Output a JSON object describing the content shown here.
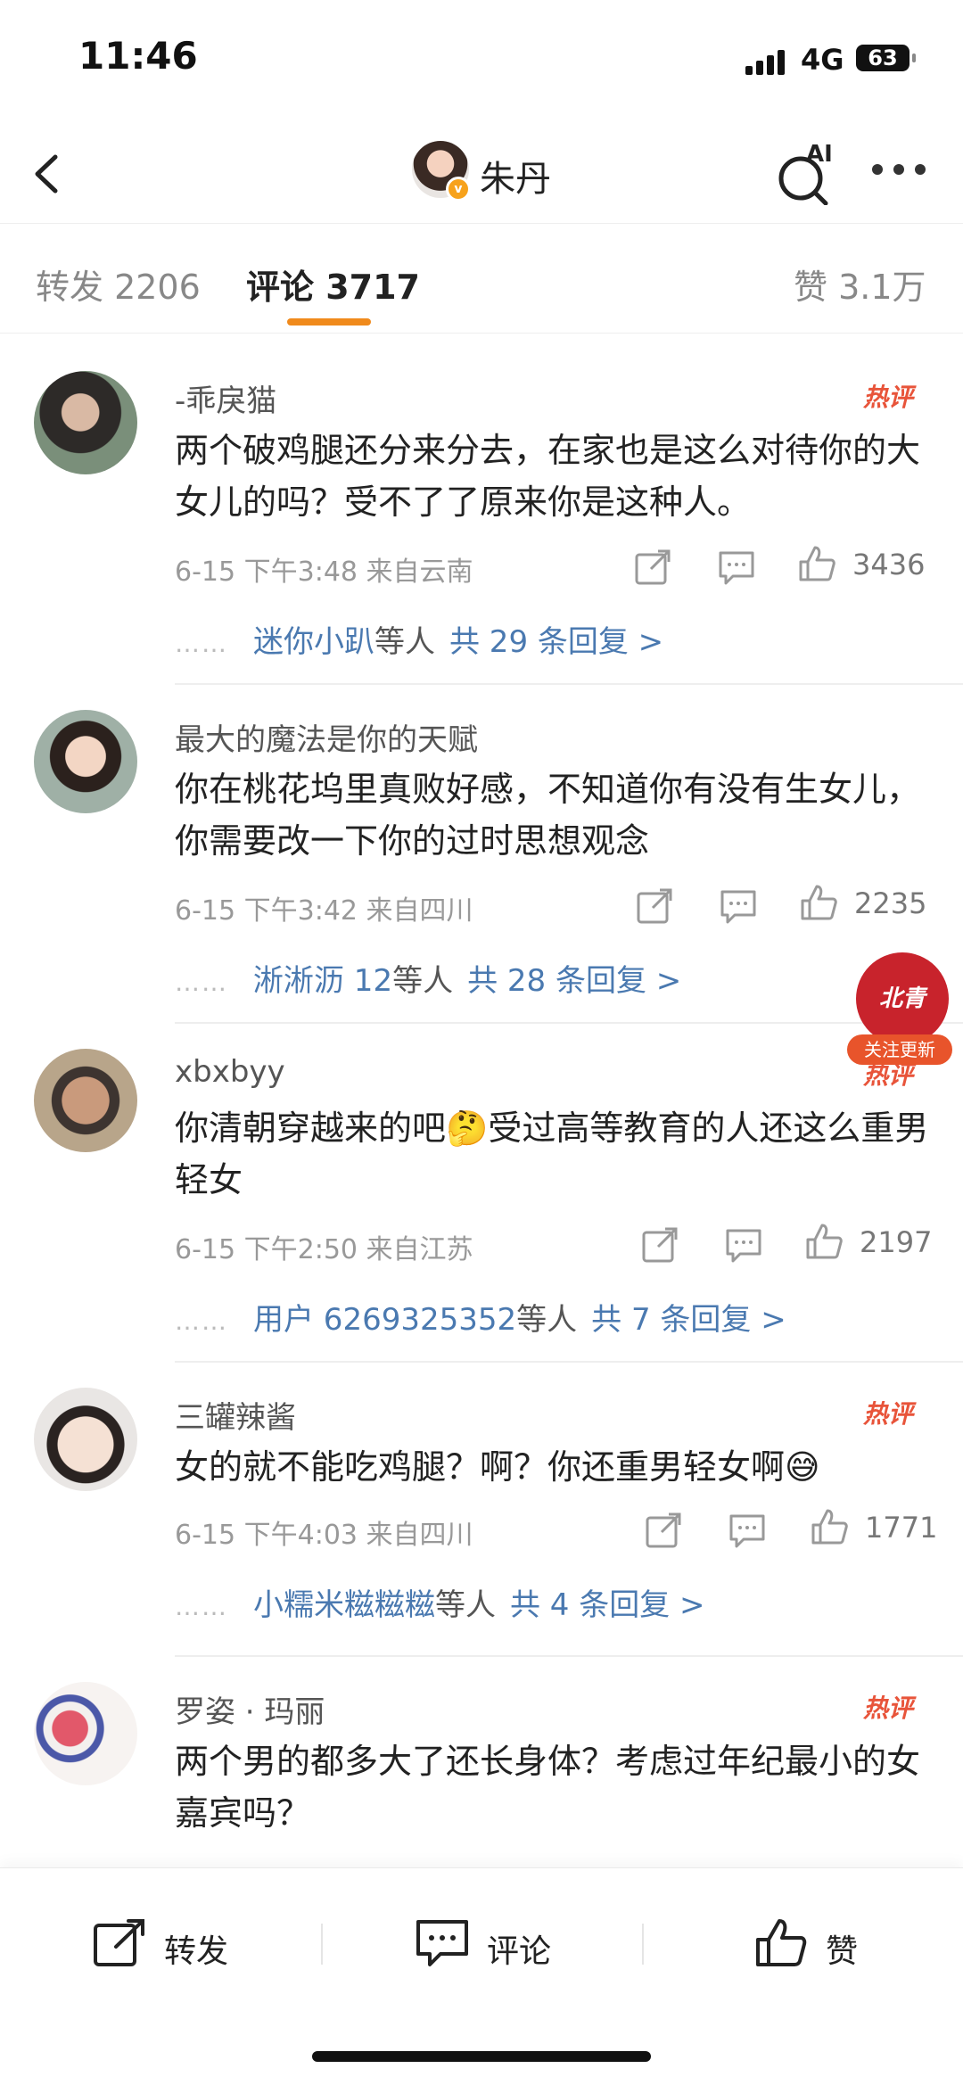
{
  "status": {
    "time": "11:46",
    "network": "4G",
    "battery": "63"
  },
  "header": {
    "title": "朱丹",
    "ai_label": "AI"
  },
  "tabs": [
    {
      "label": "转发 2206"
    },
    {
      "label": "评论 3717"
    },
    {
      "label": "赞 3.1万"
    }
  ],
  "hot_label": "热评",
  "comments": [
    {
      "user": "-乖戾猫",
      "text": "两个破鸡腿还分来分去，在家也是这么对待你的大女儿的吗？受不了了原来你是这种人。",
      "meta": "6-15  下午3:48  来自云南",
      "likes": "3436",
      "reply_dots": "……",
      "reply_names": "迷你小趴",
      "reply_mid": "等人",
      "reply_total": "共 29 条回复 >"
    },
    {
      "user": "最大的魔法是你的天赋",
      "text": "你在桃花坞里真败好感，不知道你有没有生女儿，你需要改一下你的过时思想观念",
      "meta": "6-15  下午3:42  来自四川",
      "likes": "2235",
      "reply_dots": "……",
      "reply_names": "淅淅沥 12",
      "reply_mid": "等人",
      "reply_total": "共 28 条回复 >"
    },
    {
      "user": "xbxbyy",
      "text": "你清朝穿越来的吧🤔受过高等教育的人还这么重男轻女",
      "meta": "6-15  下午2:50  来自江苏",
      "likes": "2197",
      "reply_dots": "……",
      "reply_names": "用户 6269325352",
      "reply_mid": "等人",
      "reply_total": "共 7 条回复 >"
    },
    {
      "user": "三罐辣酱",
      "text": "女的就不能吃鸡腿？啊？你还重男轻女啊😅",
      "meta": "6-15  下午4:03  来自四川",
      "likes": "1771",
      "reply_dots": "……",
      "reply_names": "小糯米糍糍糍",
      "reply_mid": "等人",
      "reply_total": "共 4 条回复 >"
    },
    {
      "user": "罗姿 · 玛丽",
      "text": "两个男的都多大了还长身体？考虑过年纪最小的女嘉宾吗？"
    }
  ],
  "float_badge": {
    "logo": "北青",
    "label": "关注更新"
  },
  "bottom_bar": {
    "repost": "转发",
    "comment": "评论",
    "like": "赞"
  }
}
